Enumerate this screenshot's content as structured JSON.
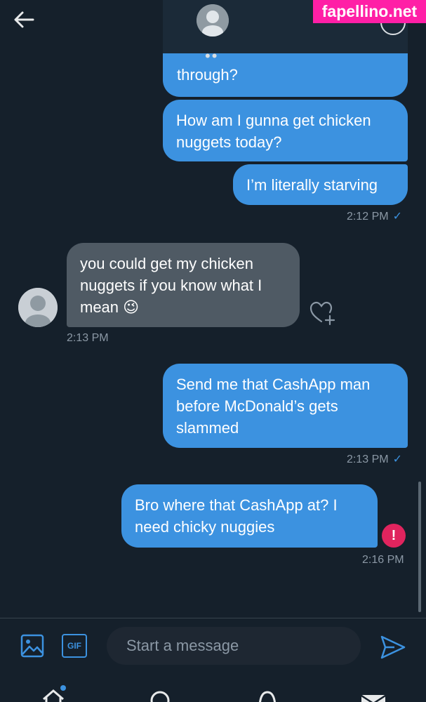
{
  "watermark": "fapellino.net",
  "header": {
    "dots": "••"
  },
  "messages": {
    "partial": "through?",
    "m1": [
      "How am I gunna get chicken",
      "nuggets today?"
    ],
    "m2": "I’m literally starving",
    "m2_time": "2:12 PM",
    "m3": [
      "you could get my chicken",
      "nuggets if you know what I",
      "mean 😉"
    ],
    "m3_time": "2:13 PM",
    "m4": [
      "Send me that CashApp man",
      "before McDonald’s gets",
      "slammed"
    ],
    "m4_time": "2:13 PM",
    "m5": [
      "Bro where that CashApp at? I",
      "need chicky nuggies"
    ],
    "m5_time": "2:16 PM",
    "checkmark": "✓",
    "error_mark": "!"
  },
  "composer": {
    "placeholder": "Start a message",
    "gif_label": "GIF"
  },
  "colors": {
    "background": "#15202b",
    "sent_bubble": "#3c92e0",
    "received_bubble": "#4f5a64",
    "error": "#e0245e"
  }
}
